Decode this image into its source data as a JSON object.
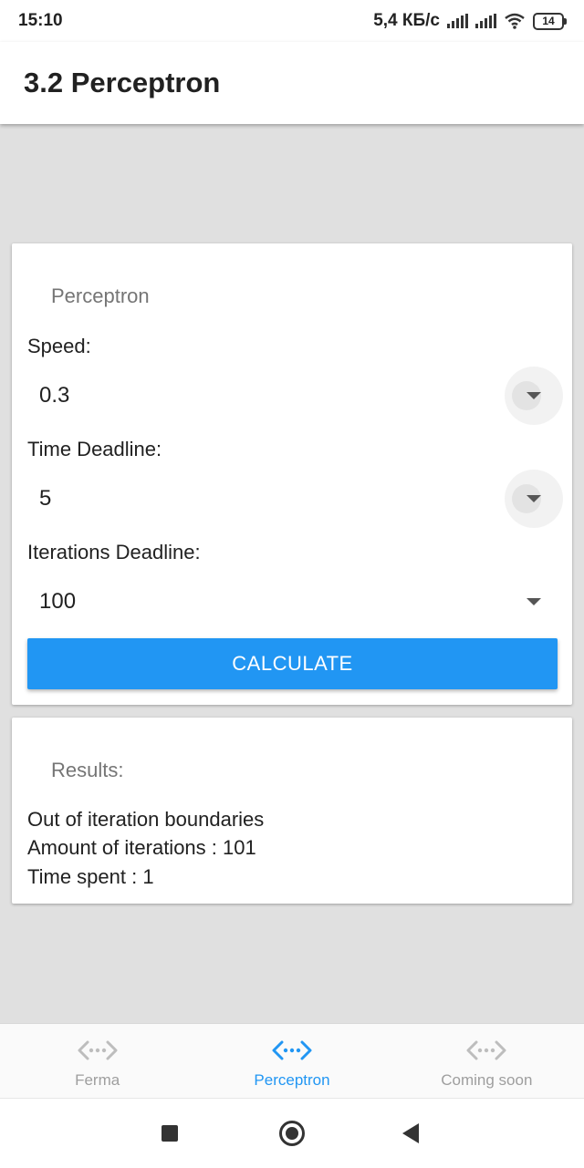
{
  "status_bar": {
    "time": "15:10",
    "network_speed": "5,4 КБ/с",
    "battery": "14"
  },
  "app_bar": {
    "title": "3.2 Perceptron"
  },
  "form_card": {
    "title": "Perceptron",
    "speed": {
      "label": "Speed:",
      "value": "0.3"
    },
    "time_deadline": {
      "label": "Time Deadline:",
      "value": "5"
    },
    "iterations_deadline": {
      "label": "Iterations Deadline:",
      "value": "100"
    },
    "calculate_label": "CALCULATE"
  },
  "results_card": {
    "title": "Results:",
    "lines": [
      "Out of iteration boundaries",
      "Amount of iterations : 101",
      "Time spent : 1"
    ]
  },
  "bottom_nav": {
    "items": [
      {
        "label": "Ferma",
        "icon": "code-arrows-icon",
        "active": false
      },
      {
        "label": "Perceptron",
        "icon": "code-arrows-icon",
        "active": true
      },
      {
        "label": "Coming soon",
        "icon": "code-arrows-icon",
        "active": false
      }
    ]
  },
  "colors": {
    "accent": "#2196f3",
    "inactive": "#9e9e9e",
    "background": "#e0e0e0"
  }
}
